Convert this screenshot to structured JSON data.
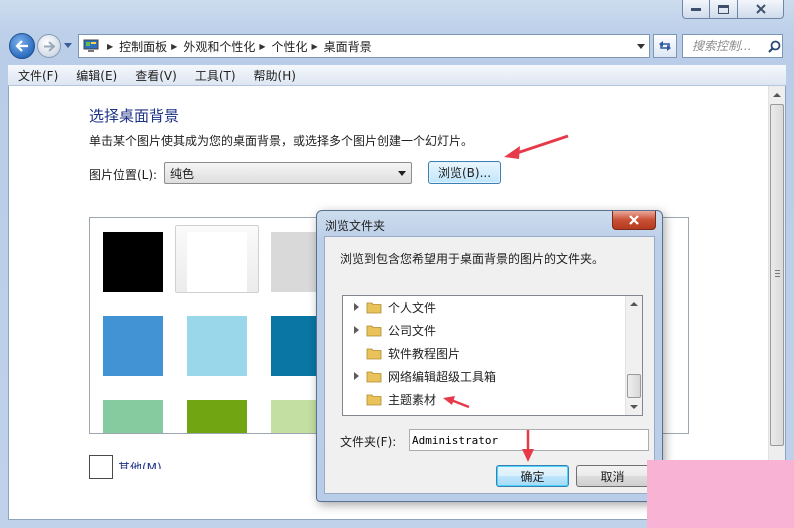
{
  "window": {
    "breadcrumb": [
      "控制面板",
      "外观和个性化",
      "个性化",
      "桌面背景"
    ],
    "search_placeholder": "搜索控制...",
    "menu": [
      "文件(F)",
      "编辑(E)",
      "查看(V)",
      "工具(T)",
      "帮助(H)"
    ]
  },
  "main": {
    "title": "选择桌面背景",
    "description": "单击某个图片使其成为您的桌面背景，或选择多个图片创建一个幻灯片。",
    "location_label": "图片位置(L):",
    "location_value": "纯色",
    "browse_label": "浏览(B)...",
    "more_colors_label": "其他(M)...",
    "swatch_colors": [
      "#000000",
      "#ffffff",
      "#d9d9d9",
      "#4293d3",
      "#9bd7ea",
      "#0976a4",
      "#86cba0",
      "#72a512",
      "#c4dfa2"
    ]
  },
  "dialog": {
    "title": "浏览文件夹",
    "message": "浏览到包含您希望用于桌面背景的图片的文件夹。",
    "tree_items": [
      {
        "label": "个人文件",
        "expandable": true
      },
      {
        "label": "公司文件",
        "expandable": true
      },
      {
        "label": "软件教程图片",
        "expandable": false
      },
      {
        "label": "网络编辑超级工具箱",
        "expandable": true
      },
      {
        "label": "主题素材",
        "expandable": false
      }
    ],
    "folder_label": "文件夹(F):",
    "folder_value": "Administrator",
    "ok_label": "确定",
    "cancel_label": "取消"
  },
  "annotation_color": "#e63a4a"
}
